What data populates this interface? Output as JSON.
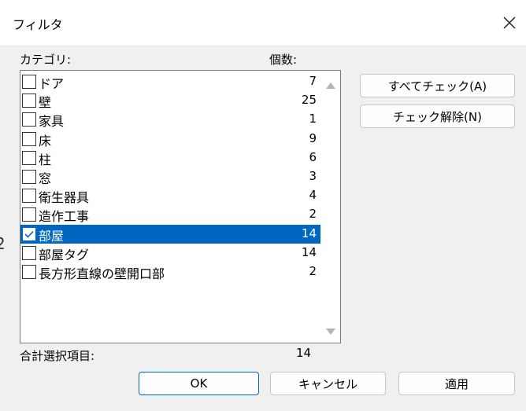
{
  "window": {
    "title": "フィルタ"
  },
  "labels": {
    "category": "カテゴリ:",
    "count": "個数:"
  },
  "items": [
    {
      "name": "ドア",
      "count": "7",
      "checked": false,
      "selected": false
    },
    {
      "name": "壁",
      "count": "25",
      "checked": false,
      "selected": false
    },
    {
      "name": "家具",
      "count": "1",
      "checked": false,
      "selected": false
    },
    {
      "name": "床",
      "count": "9",
      "checked": false,
      "selected": false
    },
    {
      "name": "柱",
      "count": "6",
      "checked": false,
      "selected": false
    },
    {
      "name": "窓",
      "count": "3",
      "checked": false,
      "selected": false
    },
    {
      "name": "衛生器具",
      "count": "4",
      "checked": false,
      "selected": false
    },
    {
      "name": "造作工事",
      "count": "2",
      "checked": false,
      "selected": false
    },
    {
      "name": "部屋",
      "count": "14",
      "checked": true,
      "selected": true
    },
    {
      "name": "部屋タグ",
      "count": "14",
      "checked": false,
      "selected": false
    },
    {
      "name": "長方形直線の壁開口部",
      "count": "2",
      "checked": false,
      "selected": false
    }
  ],
  "buttons": {
    "check_all": "すべてチェック(A)",
    "uncheck_all": "チェック解除(N)",
    "ok": "OK",
    "cancel": "キャンセル",
    "apply": "適用"
  },
  "total": {
    "label": "合計選択項目:",
    "value": "14"
  },
  "side_mark": "2",
  "icons": {
    "close": "close-icon",
    "check": "checkmark-icon",
    "scroll_up": "scroll-up-arrow",
    "scroll_down": "scroll-down-arrow"
  },
  "colors": {
    "selection": "#0067c0",
    "background": "#f0f0f0"
  }
}
